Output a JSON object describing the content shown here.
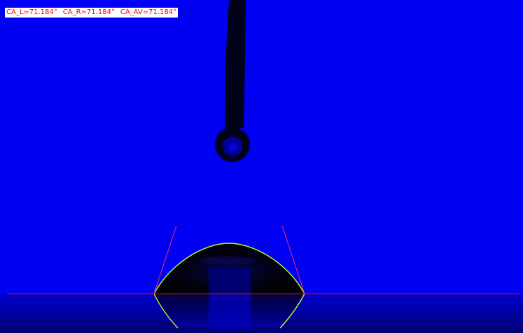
{
  "measurement": {
    "ca_left": "CA_L=71.184°",
    "ca_right": "CA_R=71.184°",
    "ca_average": "CA_AV=71.184°"
  },
  "colors": {
    "background": "#0000f2",
    "droplet": "#010104",
    "reflection_floor": "#00008a",
    "baseline": "#ff0000",
    "tangent": "#ff2a55",
    "fit_curve": "#b4ff28",
    "label_text": "#ff0000",
    "label_background": "#ffffff"
  },
  "icons": {
    "needle": "syringe-needle",
    "drop": "sessile-drop"
  }
}
